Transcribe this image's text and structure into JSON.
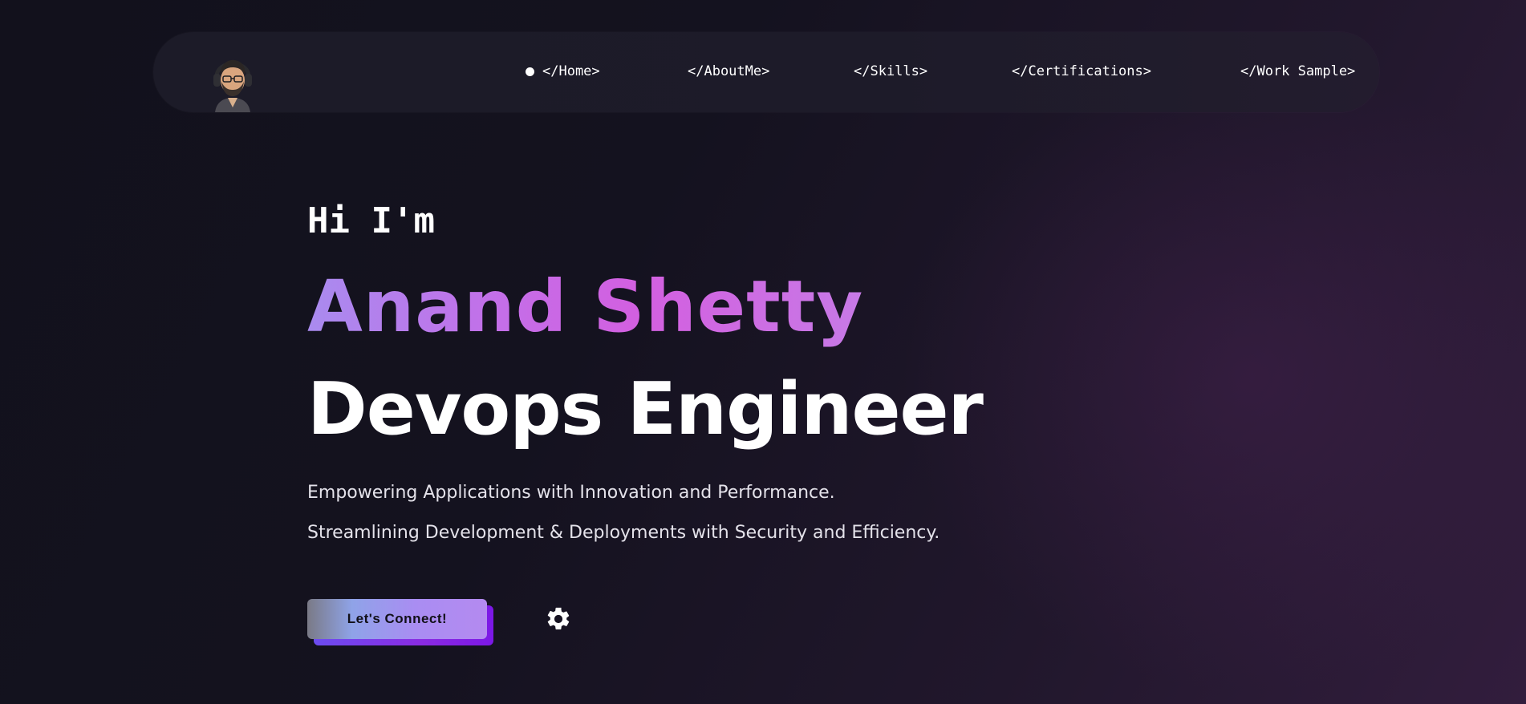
{
  "nav": {
    "avatar_icon": "avatar-icon",
    "items": [
      {
        "label": "</Home>",
        "active": true
      },
      {
        "label": "</AboutMe>"
      },
      {
        "label": "</Skills>"
      },
      {
        "label": "</Certifications>"
      },
      {
        "label": "</Work Sample>"
      }
    ]
  },
  "hero": {
    "greeting": "Hi I'm",
    "name": "Anand Shetty",
    "role": "Devops Engineer",
    "tagline_1": "Empowering Applications with Innovation and Performance.",
    "tagline_2": "Streamlining Development & Deployments with Security and Efficiency.",
    "cta_label": "Let's Connect!",
    "settings_icon": "gear-icon"
  },
  "colors": {
    "background_dark": "#12111c",
    "background_purple": "#321d3d",
    "name_gradient_start": "#a98bef",
    "name_gradient_end": "#d35fe0",
    "button_accent": "#8a2be2"
  }
}
